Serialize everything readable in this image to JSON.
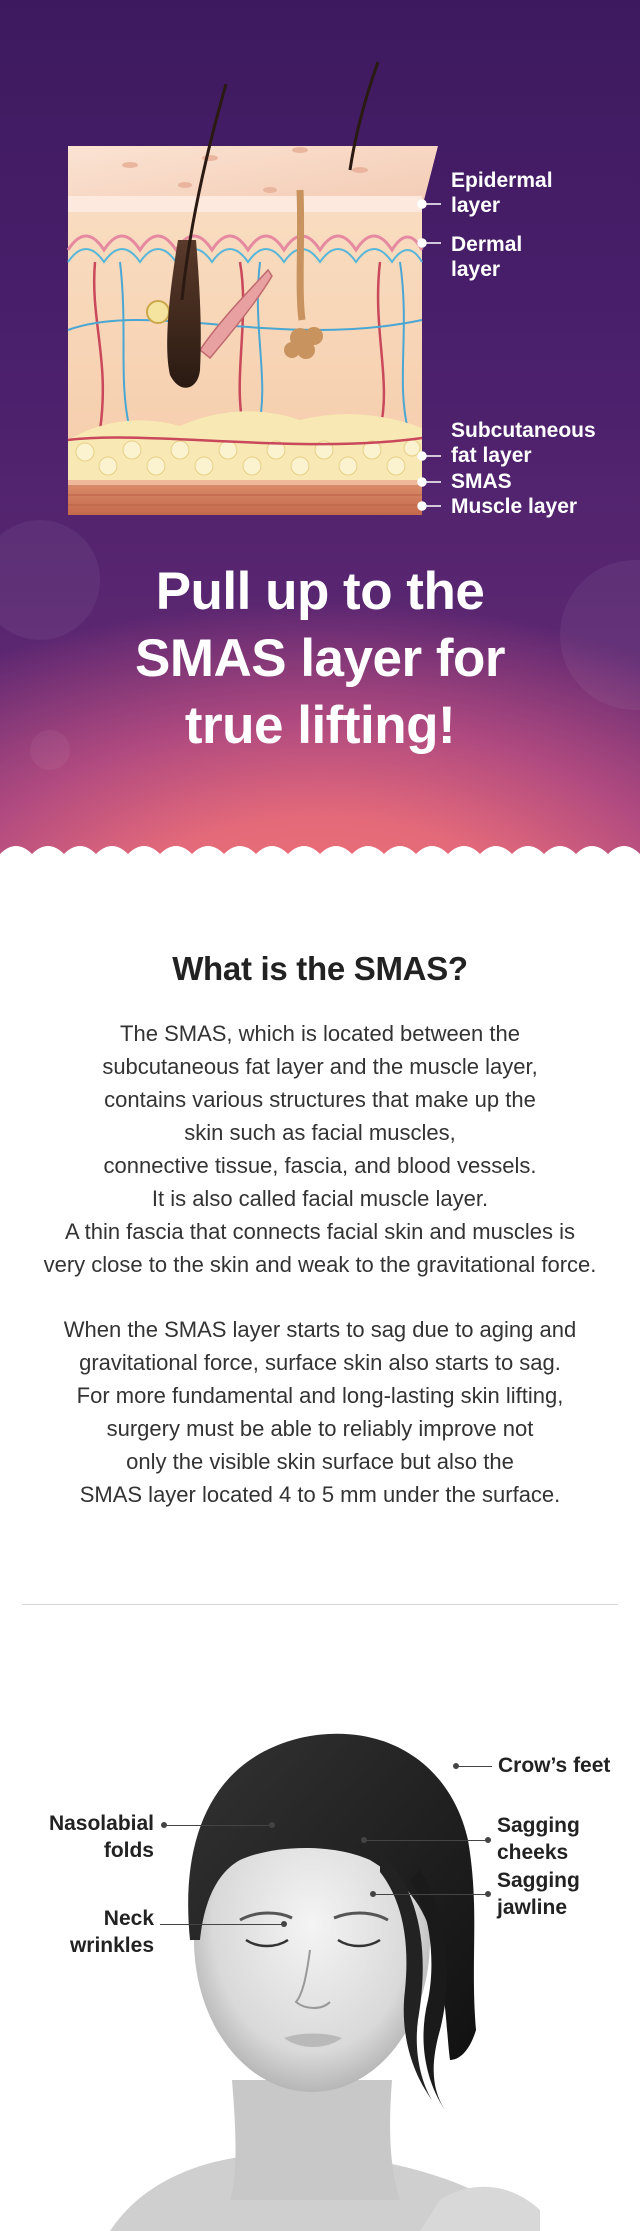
{
  "hero": {
    "layers": {
      "epidermal": [
        "Epidermal",
        "layer"
      ],
      "dermal": [
        "Dermal",
        "layer"
      ],
      "subcutaneous": [
        "Subcutaneous",
        "fat layer"
      ],
      "smas": "SMAS",
      "muscle": "Muscle layer"
    },
    "title_lines": [
      "Pull up to the",
      "SMAS layer for",
      "true lifting!"
    ]
  },
  "smas_info": {
    "heading": "What is the SMAS?",
    "paragraph1": [
      "The SMAS, which is located between the",
      "subcutaneous fat layer and the muscle layer,",
      "contains various structures that make up the",
      "skin such as facial muscles,",
      "connective tissue, fascia, and blood vessels.",
      "It is also called facial muscle layer.",
      "A thin fascia that connects facial skin and muscles is",
      "very close to the skin and weak to the gravitational force."
    ],
    "paragraph2": [
      "When the SMAS layer starts to sag due to aging and",
      "gravitational force, surface skin also starts to sag.",
      "For more fundamental and long-lasting skin lifting,",
      "surgery must be able to reliably improve not",
      "only the visible skin surface but also the",
      "SMAS layer located 4 to 5 mm under the surface."
    ]
  },
  "face": {
    "crows_feet": "Crow’s feet",
    "nasolabial": [
      "Nasolabial",
      "folds"
    ],
    "sagging_cheeks": [
      "Sagging",
      "cheeks"
    ],
    "neck": [
      "Neck",
      "wrinkles"
    ],
    "sagging_jawline": [
      "Sagging",
      "jawline"
    ]
  }
}
